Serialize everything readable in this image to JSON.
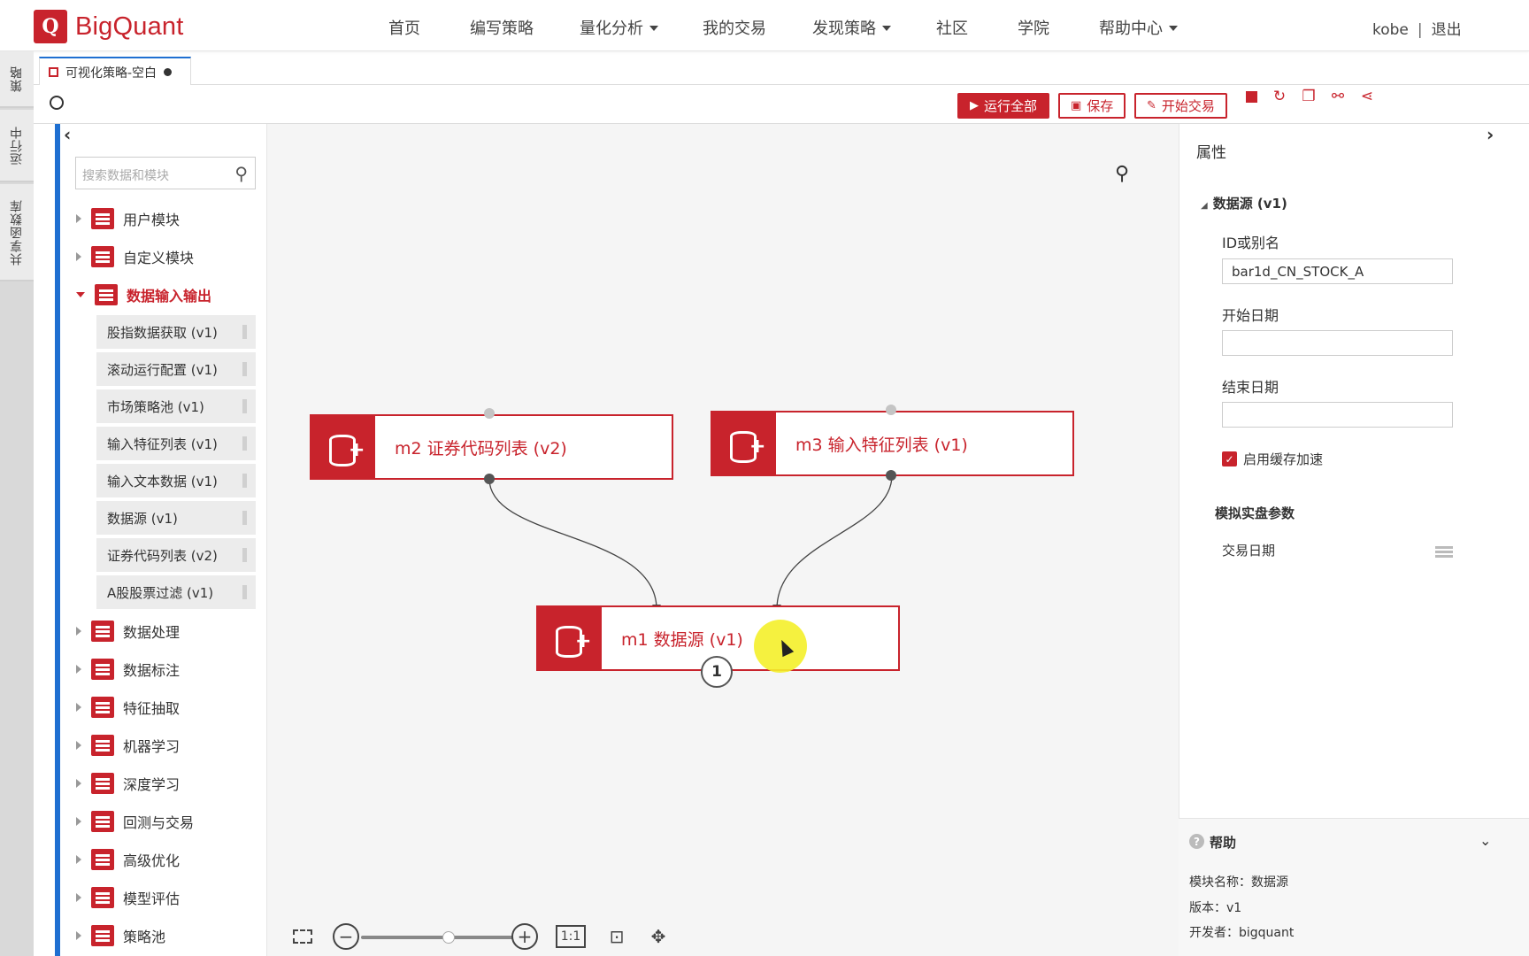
{
  "brand": {
    "logo_letter": "Q",
    "name": "BigQuant"
  },
  "nav": {
    "items": [
      {
        "label": "首页",
        "dropdown": false
      },
      {
        "label": "编写策略",
        "dropdown": false
      },
      {
        "label": "量化分析",
        "dropdown": true
      },
      {
        "label": "我的交易",
        "dropdown": false
      },
      {
        "label": "发现策略",
        "dropdown": true
      },
      {
        "label": "社区",
        "dropdown": false
      },
      {
        "label": "学院",
        "dropdown": false
      },
      {
        "label": "帮助中心",
        "dropdown": true
      }
    ],
    "user": "kobe",
    "separator": "|",
    "logout": "退出"
  },
  "side_tabs": [
    "策略",
    "运行中",
    "共享函数库"
  ],
  "doc_tab": {
    "title": "可视化策略-空白"
  },
  "toolbar": {
    "run_all": "运行全部",
    "save": "保存",
    "start_trade": "开始交易"
  },
  "left_panel": {
    "search_placeholder": "搜索数据和模块",
    "categories": [
      {
        "label": "用户模块",
        "open": false
      },
      {
        "label": "自定义模块",
        "open": false
      },
      {
        "label": "数据输入输出",
        "open": true
      }
    ],
    "sub_items": [
      "股指数据获取 (v1)",
      "滚动运行配置 (v1)",
      "市场策略池 (v1)",
      "输入特征列表 (v1)",
      "输入文本数据 (v1)",
      "数据源 (v1)",
      "证券代码列表 (v2)",
      "A股股票过滤 (v1)"
    ],
    "categories_after": [
      "数据处理",
      "数据标注",
      "特征抽取",
      "机器学习",
      "深度学习",
      "回测与交易",
      "高级优化",
      "模型评估",
      "策略池"
    ]
  },
  "canvas": {
    "nodes": [
      {
        "id": "m2",
        "label": "m2 证券代码列表 (v2)"
      },
      {
        "id": "m3",
        "label": "m3 输入特征列表 (v1)"
      },
      {
        "id": "m1",
        "label": "m1 数据源 (v1)"
      }
    ],
    "badge": "1",
    "zoom_labels": {
      "fit": "1:1"
    }
  },
  "properties": {
    "title": "属性",
    "section": "数据源 (v1)",
    "id_label": "ID或别名",
    "id_value": "bar1d_CN_STOCK_A",
    "start_label": "开始日期",
    "start_value": "",
    "end_label": "结束日期",
    "end_value": "",
    "cache_label": "启用缓存加速",
    "cache_checked": true,
    "sim_section": "模拟实盘参数",
    "trade_date_label": "交易日期"
  },
  "help": {
    "title": "帮助",
    "module_name": "模块名称：数据源",
    "version": "版本：v1",
    "developer": "开发者：bigquant"
  },
  "colors": {
    "brand": "#c8232c",
    "accent": "#1f6fd1"
  }
}
